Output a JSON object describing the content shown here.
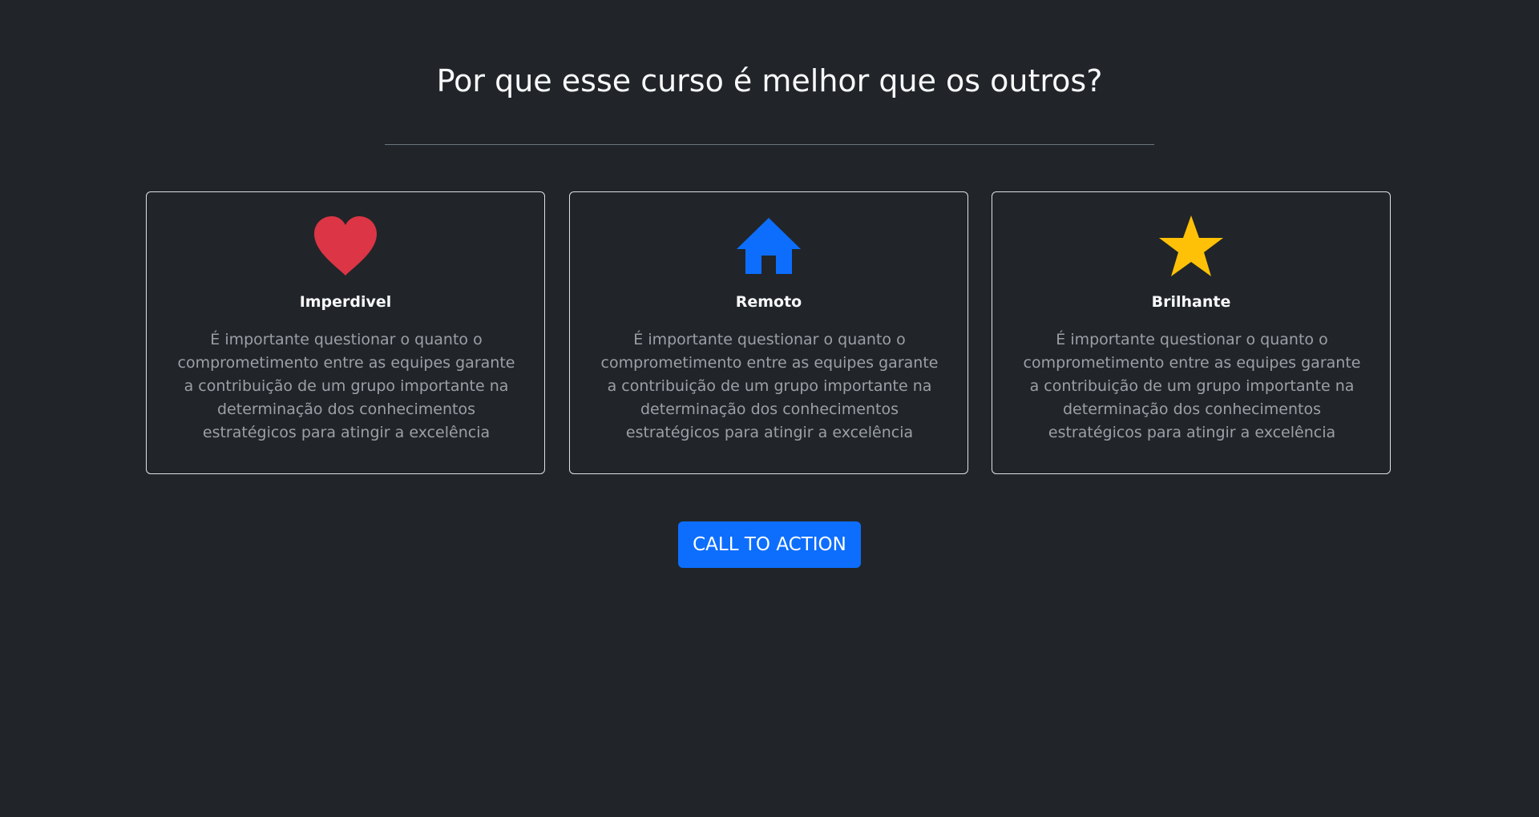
{
  "section": {
    "title": "Por que esse curso é melhor que os outros?"
  },
  "cards": [
    {
      "icon": "heart-icon",
      "icon_color": "#dc3545",
      "title": "Imperdivel",
      "text": "É importante questionar o quanto o comprometimento entre as equipes garante a contribuição de um grupo importante na determinação dos conhecimentos estratégicos para atingir a excelência"
    },
    {
      "icon": "house-icon",
      "icon_color": "#0d6efd",
      "title": "Remoto",
      "text": "É importante questionar o quanto o comprometimento entre as equipes garante a contribuição de um grupo importante na determinação dos conhecimentos estratégicos para atingir a excelência"
    },
    {
      "icon": "star-icon",
      "icon_color": "#ffc107",
      "title": "Brilhante",
      "text": "É importante questionar o quanto o comprometimento entre as equipes garante a contribuição de um grupo importante na determinação dos conhecimentos estratégicos para atingir a excelência"
    }
  ],
  "cta": {
    "label": "CALL TO ACTION",
    "color": "#0d6efd"
  },
  "colors": {
    "background": "#212529",
    "text": "#f8f9fa",
    "muted_text": "#9aa0a6",
    "card_border": "#dee2e6"
  }
}
